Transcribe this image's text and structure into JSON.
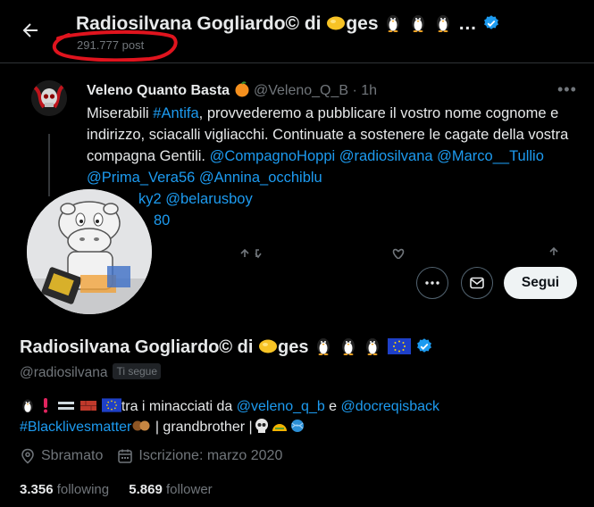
{
  "header": {
    "title": "Radiosilvana Gogliardo© di ",
    "title_suffix": "ges",
    "ellipsis": "…",
    "post_count": "291.777 post",
    "back_icon": "arrow-left-icon",
    "annotation_color": "#e0141e"
  },
  "banner_tweet": {
    "author_name": "Veleno Quanto Basta",
    "handle": "@Veleno_Q_B",
    "time": "· 1h",
    "line1_a": "Miserabili ",
    "hashtag": "#Antifa",
    "line1_b": ", provvederemo a pubblicare il vostro nome cognome e indirizzo, sciacalli vigliacchi. Continuate a sostenere le cagate della vostra compagna Gentili. ",
    "mentions1": "@CompagnoHoppi @radiosilvana @Marco__Tullio @Prima_Vera56 @Annina_occhiblu",
    "mentions2": "ky2 @belarusboy",
    "mentions3": "80"
  },
  "actions": {
    "more_label": "More",
    "message_label": "Message",
    "follow_label": "Segui"
  },
  "profile": {
    "name": "Radiosilvana Gogliardo© di ",
    "name_suffix": "ges",
    "handle": "@radiosilvana",
    "follows_you": "Ti segue",
    "bio_prefix": "tra i minacciati da ",
    "bio_mention1": "@veleno_q_b",
    "bio_and": " e ",
    "bio_mention2": "@docreqisback",
    "bio_hashtag": "#Blacklivesmatter",
    "bio_suffix": " | grandbrother |",
    "location": "Sbramato",
    "joined": "Iscrizione: marzo 2020",
    "following_count": "3.356",
    "following_label": "following",
    "follower_count": "5.869",
    "follower_label": "follower"
  },
  "colors": {
    "background": "#000000",
    "text": "#e7e9ea",
    "secondary": "#71767b",
    "link": "#1d9bf0",
    "verified": "#1d9bf0"
  }
}
